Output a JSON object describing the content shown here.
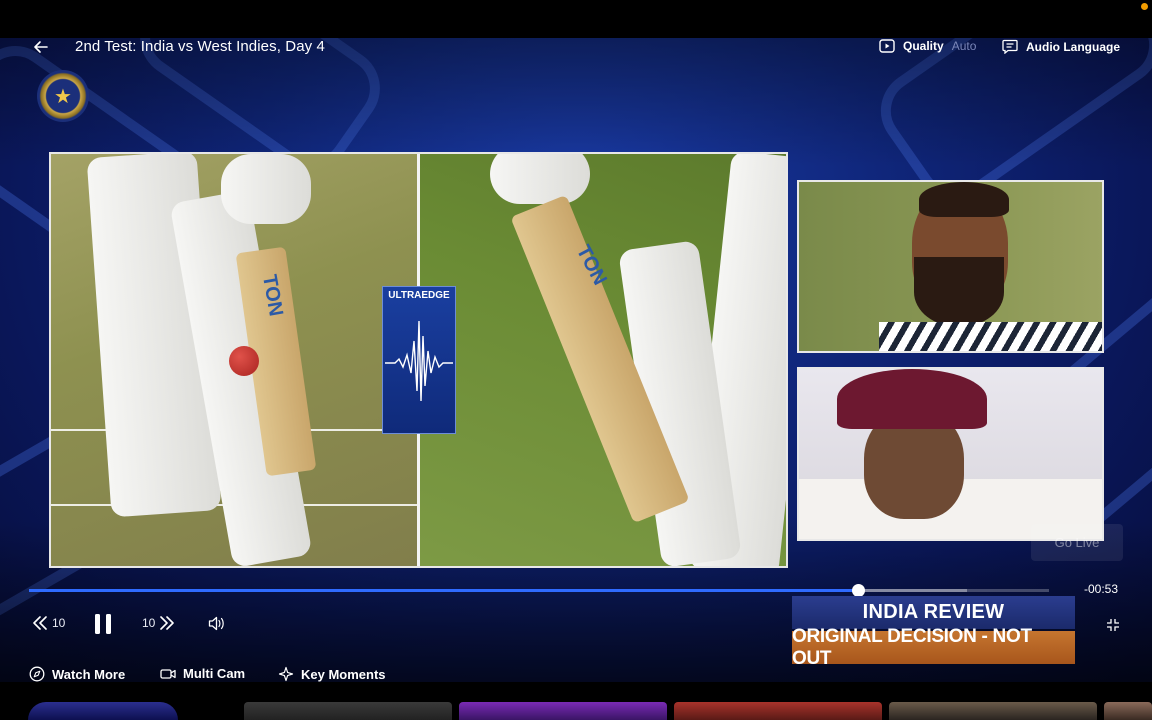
{
  "header": {
    "title": "2nd Test: India vs West Indies, Day 4",
    "quality_label": "Quality",
    "quality_value": "Auto",
    "audio_label": "Audio Language"
  },
  "overlay": {
    "ultraedge_label": "ULTRAEDGE",
    "bat_brand": "TON",
    "go_live_label": "Go Live"
  },
  "player": {
    "time_remaining": "-00:53",
    "played_fraction": 0.813,
    "buffered_fraction": 0.92,
    "rewind_seconds": "10",
    "forward_seconds": "10"
  },
  "banner": {
    "line1": "INDIA REVIEW",
    "line2": "ORIGINAL DECISION - NOT OUT"
  },
  "menu": {
    "watch_more": "Watch More",
    "multi_cam": "Multi Cam",
    "key_moments": "Key Moments"
  },
  "colors": {
    "accent": "#2f6bff",
    "banner_top": "#1b2a6b",
    "banner_bottom": "#a8561c",
    "recording_dot": "#f29d00"
  }
}
